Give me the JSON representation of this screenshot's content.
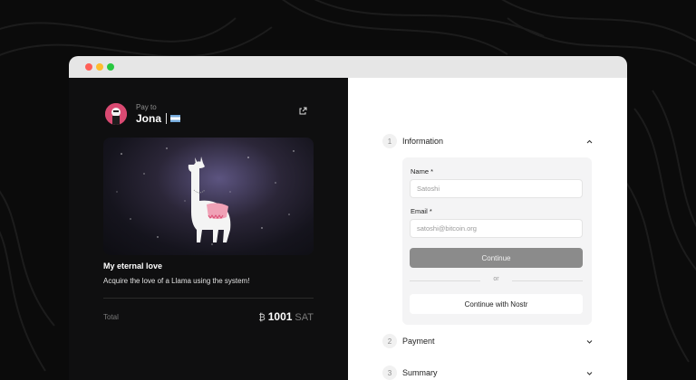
{
  "colors": {
    "left_panel_bg": "#0f0f10",
    "right_panel_bg": "#ffffff",
    "continue_bg": "#8b8b8b",
    "form_panel_bg": "#f4f4f5"
  },
  "window": {
    "controls": [
      "close",
      "minimize",
      "maximize"
    ]
  },
  "merchant": {
    "pay_to_label": "Pay to",
    "name": "Jona",
    "flag_icon": "argentina-flag-icon",
    "external_link_icon": "external-link-icon"
  },
  "product": {
    "title": "My eternal love",
    "description": "Acquire the love of a Llama using the system!"
  },
  "total": {
    "label": "Total",
    "currency_symbol": "₿",
    "amount": "1001",
    "unit": "SAT"
  },
  "steps": [
    {
      "number": "1",
      "label": "Information",
      "expanded": true
    },
    {
      "number": "2",
      "label": "Payment",
      "expanded": false
    },
    {
      "number": "3",
      "label": "Summary",
      "expanded": false
    }
  ],
  "form": {
    "name_label": "Name *",
    "name_placeholder": "Satoshi",
    "email_label": "Email *",
    "email_placeholder": "satoshi@bitcoin.org",
    "continue_label": "Continue",
    "or_label": "or",
    "nostr_label": "Continue with Nostr"
  }
}
